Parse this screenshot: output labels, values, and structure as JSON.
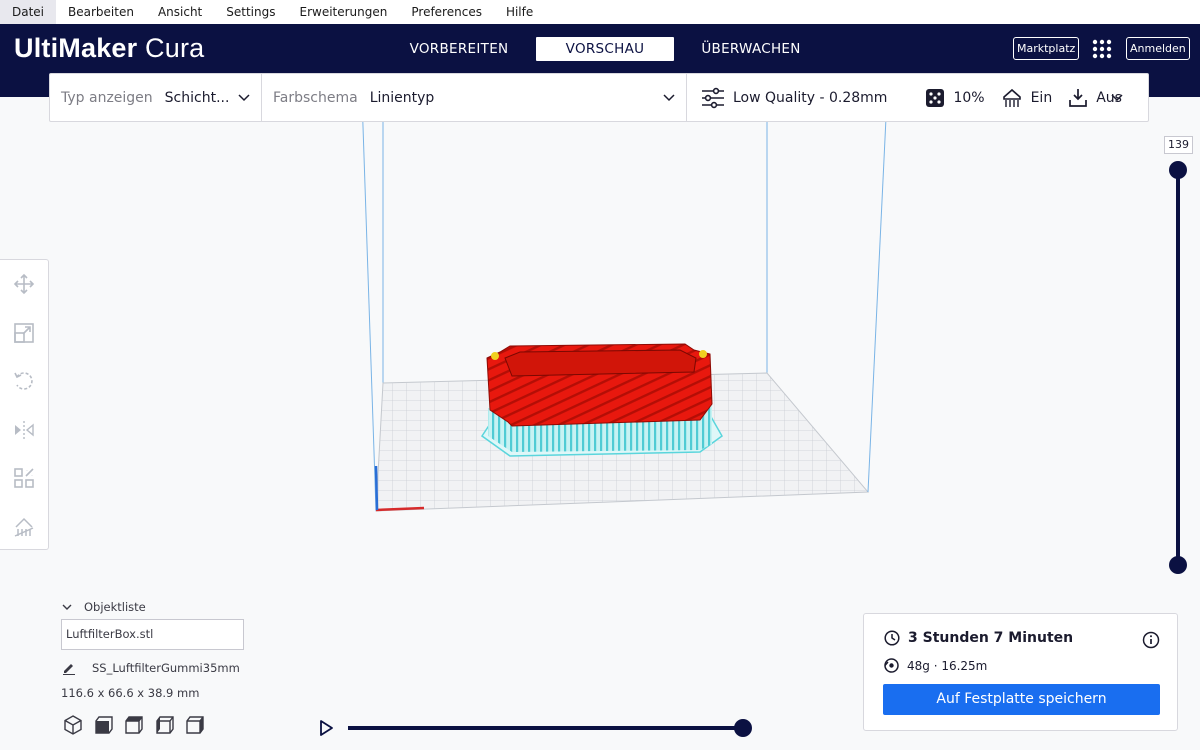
{
  "menu": [
    "Datei",
    "Bearbeiten",
    "Ansicht",
    "Settings",
    "Erweiterungen",
    "Preferences",
    "Hilfe"
  ],
  "header": {
    "logo_bold": "UltiMaker",
    "logo_light": "Cura",
    "stages": [
      {
        "label": "VORBEREITEN",
        "active": false
      },
      {
        "label": "VORSCHAU",
        "active": true
      },
      {
        "label": "ÜBERWACHEN",
        "active": false
      }
    ],
    "marketplace_label": "Marktplatz",
    "apps_icon": "grid-icon",
    "signin_label": "Anmelden"
  },
  "settings_bar": {
    "view_type_label": "Typ anzeigen",
    "view_type_value": "Schicht...",
    "color_scheme_label": "Farbschema",
    "color_scheme_value": "Linientyp",
    "quality": "Low Quality - 0.28mm",
    "infill": "10%",
    "support": "Ein",
    "adhesion": "Aus"
  },
  "toolbar": {
    "tools": [
      "move-icon",
      "scale-icon",
      "rotate-icon",
      "mirror-icon",
      "per-model-settings-icon",
      "support-blocker-icon"
    ]
  },
  "layer_slider": {
    "current_layer": "139",
    "upper_fraction": 1.0,
    "lower_fraction": 0.0
  },
  "object_list": {
    "title": "Objektliste",
    "items": [
      "LuftfilterBox.stl"
    ],
    "job_name": "SS_LuftfilterGummi35mm",
    "dimensions": "116.6 x 66.6 x 38.9 mm",
    "view_icons": [
      "view-3d-icon",
      "view-front-icon",
      "view-top-icon",
      "view-left-icon",
      "view-right-icon"
    ]
  },
  "playback": {
    "progress_fraction": 1.0
  },
  "print_info": {
    "time": "3 Stunden 7 Minuten",
    "material": "48g · 16.25m",
    "save_label": "Auf Festplatte speichern"
  },
  "colors": {
    "header_bg": "#0b1142",
    "accent_blue": "#196ef0",
    "wall_red": "#e8180e",
    "support_cyan": "#5ad5dc",
    "build_volume_line": "#7ab4e6"
  }
}
